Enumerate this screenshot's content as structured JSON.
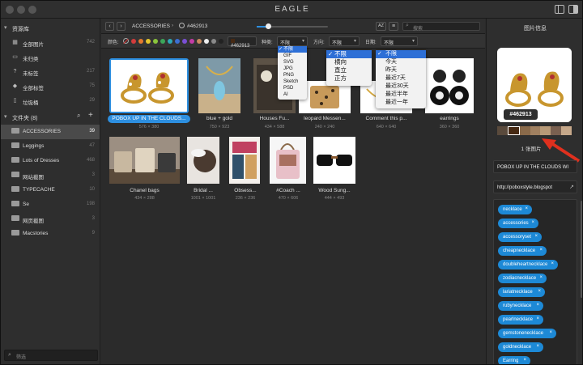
{
  "app": {
    "title": "EAGLE"
  },
  "sidebar": {
    "library_header": "资源库",
    "library_items": [
      {
        "icon": "grid-icon",
        "label": "全部图片",
        "count": "742"
      },
      {
        "icon": "inbox-icon",
        "label": "未归类",
        "count": ""
      },
      {
        "icon": "question-icon",
        "label": "未标签",
        "count": "217"
      },
      {
        "icon": "tag-icon",
        "label": "全部标签",
        "count": "75"
      },
      {
        "icon": "trash-icon",
        "label": "垃圾桶",
        "count": "29"
      }
    ],
    "folders_header": "文件夹 (8)",
    "folders": [
      {
        "label": "ACCESSORIES",
        "count": "39",
        "active": true
      },
      {
        "label": "Leggings",
        "count": "47",
        "active": false
      },
      {
        "label": "Lots of Dresses",
        "count": "468",
        "active": false
      },
      {
        "label": "网站截图",
        "count": "3",
        "active": false
      },
      {
        "label": "TYPECACHE",
        "count": "10",
        "active": false
      },
      {
        "label": "Se",
        "count": "198",
        "active": false
      },
      {
        "label": "网页截图",
        "count": "3",
        "active": false
      },
      {
        "label": "Macstories",
        "count": "9",
        "active": false
      }
    ],
    "filter_placeholder": "筛选"
  },
  "toolbar": {
    "breadcrumb": "ACCESSORIES",
    "color_hex": "#462913",
    "search_placeholder": "搜索",
    "sort_label": "AZ"
  },
  "filterbar": {
    "color_label": "颜色:",
    "colors": [
      "#d33c3c",
      "#e57a2e",
      "#e6c72e",
      "#8ac43c",
      "#3ca65a",
      "#2ea9b8",
      "#3c6fd3",
      "#7a4fd3",
      "#c43ca6",
      "#c98a5e",
      "#eeeeee",
      "#8a8a8a",
      "#222222"
    ],
    "color_value": "#462913",
    "type_label": "种类:",
    "type_value": "不限",
    "direction_label": "方向:",
    "direction_value": "不限",
    "date_label": "日期:",
    "date_value": "不限"
  },
  "dropdowns": {
    "type_options": [
      "不限",
      "GIF",
      "SVG",
      "JPG",
      "PNG",
      "Sketch",
      "PSD",
      "AI"
    ],
    "direction_options": [
      "不限",
      "横向",
      "直立",
      "正方"
    ],
    "date_options": [
      "不限",
      "今天",
      "昨天",
      "最近7天",
      "最近30天",
      "最近半年",
      "最近一年"
    ]
  },
  "grid": {
    "row1": [
      {
        "name": "POBOX UP IN THE CLOUDS...",
        "size": "576 × 380",
        "selected": true
      },
      {
        "name": "blue + gold",
        "size": "750 × 923",
        "selected": false
      },
      {
        "name": "Houses Fu...",
        "size": "434 × 588",
        "selected": false
      },
      {
        "name": "leopard Messen...",
        "size": "240 × 240",
        "selected": false
      },
      {
        "name": "Comment this p...",
        "size": "640 × 640",
        "selected": false
      },
      {
        "name": "earrings",
        "size": "360 × 360",
        "selected": false
      }
    ],
    "row2": [
      {
        "name": "Chanel bags",
        "size": "434 × 288"
      },
      {
        "name": "Bridal ...",
        "size": "1001 × 1001"
      },
      {
        "name": "Obsess...",
        "size": "236 × 236"
      },
      {
        "name": "#Coach ...",
        "size": "470 × 606"
      },
      {
        "name": "Wood Sung...",
        "size": "444 × 493"
      }
    ]
  },
  "info_panel": {
    "title": "图片信息",
    "preview_hex": "#462913",
    "palette": [
      "#5a4a3c",
      "#462913",
      "#8a6a4a",
      "#a08060",
      "#b89a78",
      "#7a6050",
      "#c6a88a"
    ],
    "image_count": "1 张图片",
    "name": "POBOX UP IN THE CLOUDS WI",
    "url": "http://poboxstyle.blogspot",
    "tags": [
      "necklace",
      "accessories",
      "accessoryset",
      "cheapnecklace",
      "doubleheartnecklace",
      "zodiacnecklace",
      "lariatnecklace",
      "rubynecklace",
      "pearlnecklace",
      "gemstonenecklace",
      "goldnecklace",
      "Earring"
    ]
  }
}
